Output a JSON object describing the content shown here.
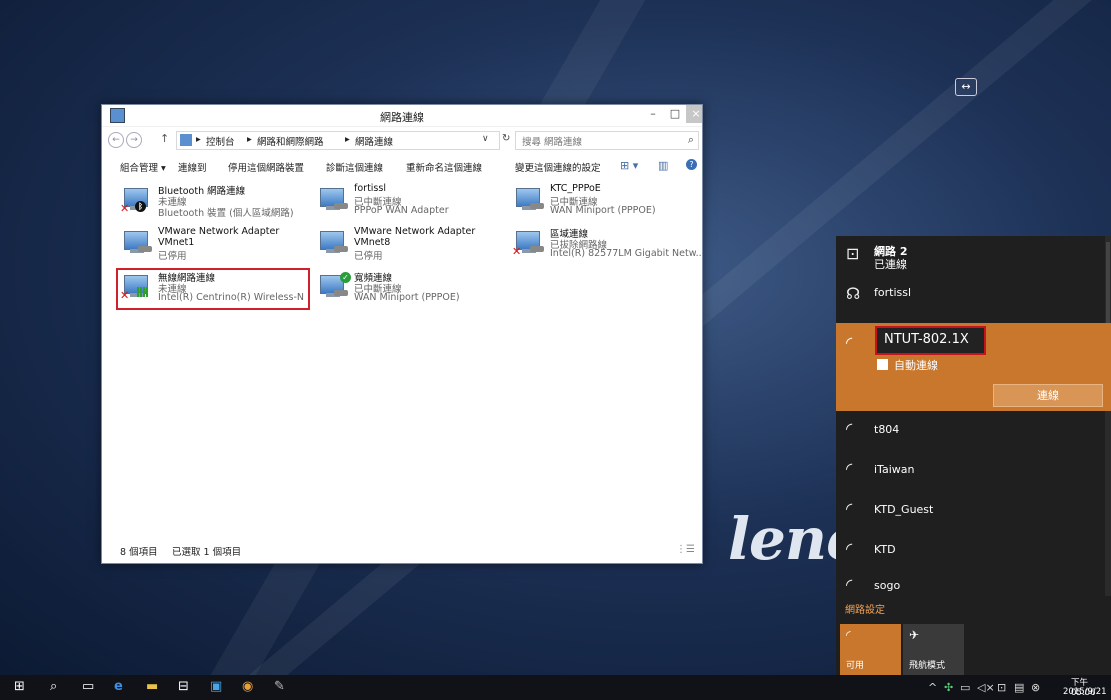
{
  "window": {
    "title": "網路連線",
    "buttons": {
      "minimize": "–",
      "maximize": "□",
      "close": "×"
    }
  },
  "address": {
    "back": "←",
    "forward": "→",
    "up": "↑",
    "breadcrumbs": [
      "控制台",
      "網路和網際網路",
      "網路連線"
    ],
    "separator": "▸",
    "dropdown": "∨",
    "refresh": "↻",
    "search_placeholder": "搜尋 網路連線",
    "search_icon": "⌕"
  },
  "toolbar": {
    "organize": "組合管理 ▾",
    "connect_to": "連線到",
    "disable": "停用這個網路裝置",
    "diagnose": "診斷這個連線",
    "rename": "重新命名這個連線",
    "change_settings": "變更這個連線的設定",
    "view_icon": "⊞ ▾",
    "pane_icon": "▥",
    "help_icon": "?"
  },
  "connections": [
    {
      "name": "Bluetooth 網路連線",
      "status": "未連線",
      "device": "Bluetooth 裝置 (個人區域網路)",
      "badge": "bt-x"
    },
    {
      "name": "fortissl",
      "status": "已中斷連線",
      "device": "PPPoP WAN Adapter",
      "badge": "cable"
    },
    {
      "name": "KTC_PPPoE",
      "status": "已中斷連線",
      "device": "WAN Miniport (PPPOE)",
      "badge": "cable"
    },
    {
      "name": "VMware Network Adapter VMnet1",
      "name_l1": "VMware Network Adapter",
      "name_l2": "VMnet1",
      "status": "已停用",
      "device": "",
      "badge": "cable"
    },
    {
      "name": "VMware Network Adapter VMnet8",
      "name_l1": "VMware Network Adapter",
      "name_l2": "VMnet8",
      "status": "已停用",
      "device": "",
      "badge": "cable"
    },
    {
      "name": "區域連線",
      "status": "已拔除網路線",
      "device": "Intel(R) 82577LM Gigabit Netw...",
      "badge": "x"
    },
    {
      "name": "無線網路連線",
      "status": "未連線",
      "device": "Intel(R) Centrino(R) Wireless-N ...",
      "badge": "bars-x",
      "selected": true
    },
    {
      "name": "寬頻連線",
      "status": "已中斷連線",
      "device": "WAN Miniport (PPPOE)",
      "badge": "ok"
    }
  ],
  "status_bar": {
    "item_count": "8 個項目",
    "selected_count": "已選取 1 個項目"
  },
  "flyout": {
    "network2_name": "網路 2",
    "network2_status": "已連線",
    "networks": [
      {
        "name": "fortissl",
        "icon": "dialup-icon"
      },
      {
        "name": "t804",
        "icon": "wifi-secured-icon"
      },
      {
        "name": "iTaiwan",
        "icon": "wifi-secured-icon"
      },
      {
        "name": "KTD_Guest",
        "icon": "wifi-icon"
      },
      {
        "name": "KTD",
        "icon": "wifi-icon"
      },
      {
        "name": "sogo",
        "icon": "wifi-icon"
      }
    ],
    "selected": {
      "name": "NTUT-802.1X",
      "auto_connect_label": "自動連線",
      "auto_connect_checked": false,
      "connect_button": "連線"
    },
    "settings_link": "網路設定",
    "quick_actions": [
      {
        "label": "可用",
        "icon": "wifi-icon",
        "active": true
      },
      {
        "label": "飛航模式",
        "icon": "airplane-icon",
        "active": false
      }
    ]
  },
  "taskbar": {
    "tray_expand": "^",
    "time": "下午 05:06",
    "date": "2015/9/21"
  },
  "wallpaper_text": "lenc"
}
